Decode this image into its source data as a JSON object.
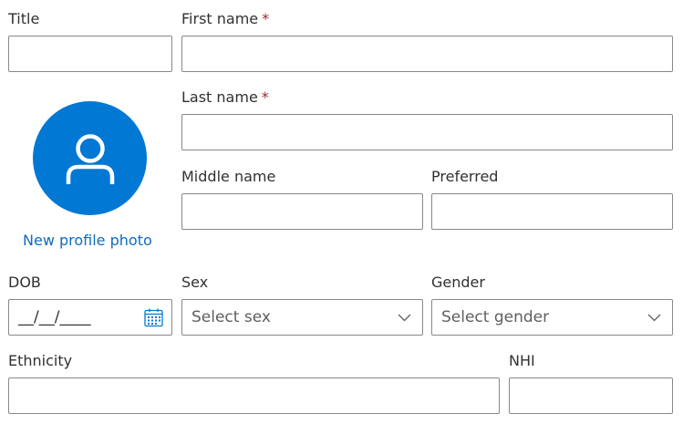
{
  "fields": {
    "title": {
      "label": "Title",
      "value": ""
    },
    "first_name": {
      "label": "First name",
      "required_mark": "*",
      "value": ""
    },
    "last_name": {
      "label": "Last name",
      "required_mark": "*",
      "value": ""
    },
    "middle_name": {
      "label": "Middle name",
      "value": ""
    },
    "preferred": {
      "label": "Preferred",
      "value": ""
    },
    "dob": {
      "label": "DOB",
      "placeholder": "__/__/____"
    },
    "sex": {
      "label": "Sex",
      "placeholder": "Select sex"
    },
    "gender": {
      "label": "Gender",
      "placeholder": "Select gender"
    },
    "ethnicity": {
      "label": "Ethnicity",
      "value": ""
    },
    "nhi": {
      "label": "NHI",
      "value": ""
    }
  },
  "profile": {
    "new_photo_link": "New profile photo",
    "avatar_icon": "person-icon"
  },
  "icons": {
    "dob": "calendar-icon",
    "dropdown": "chevron-down-icon"
  },
  "colors": {
    "accent": "#0078d4",
    "link": "#0f6cbd",
    "required": "#a4262c",
    "border": "#8a8886"
  }
}
